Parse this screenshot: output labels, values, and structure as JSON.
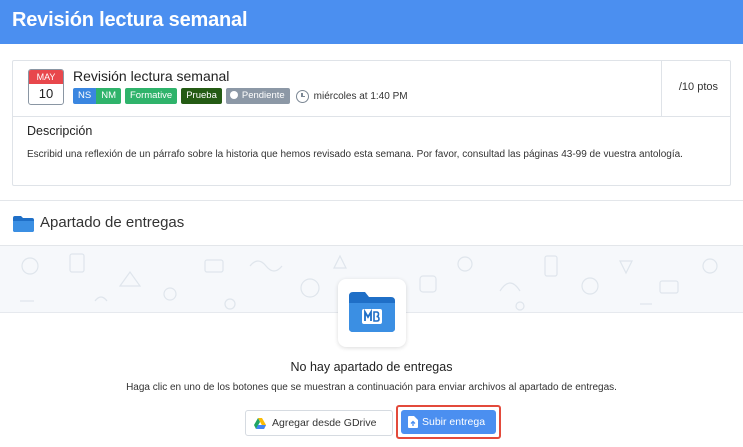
{
  "header": {
    "title": "Revisión lectura semanal"
  },
  "task": {
    "calendar": {
      "month": "MAY",
      "day": "10"
    },
    "title": "Revisión lectura semanal",
    "tags": {
      "ns": "NS",
      "nm": "NM",
      "formative": "Formative",
      "prueba": "Prueba",
      "pendiente": "Pendiente"
    },
    "due": "miércoles at 1:40 PM",
    "points": "/10 ptos",
    "description_label": "Descripción",
    "description": "Escribid una reflexión de un párrafo sobre la historia que hemos revisado esta semana. Por favor, consultad las páginas 43-99 de vuestra antología."
  },
  "dropbox": {
    "section_title": "Apartado de entregas",
    "empty_title": "No hay apartado de entregas",
    "empty_subtitle": "Haga clic en uno de los botones que se muestran a continuación para enviar archivos al apartado de entregas.",
    "gdrive_button": "Agregar desde GDrive",
    "upload_button": "Subir entrega"
  },
  "colors": {
    "header": "#4b8ff0",
    "ns": "#3a86e0",
    "nm": "#2fb36b",
    "formative": "#2fb36b",
    "prueba": "#245b14",
    "pendiente": "#8c98a6",
    "highlight": "#e34a3b"
  },
  "icons": [
    "clock-icon",
    "folder-icon",
    "managebac-folder-icon",
    "google-drive-icon",
    "upload-file-icon"
  ]
}
